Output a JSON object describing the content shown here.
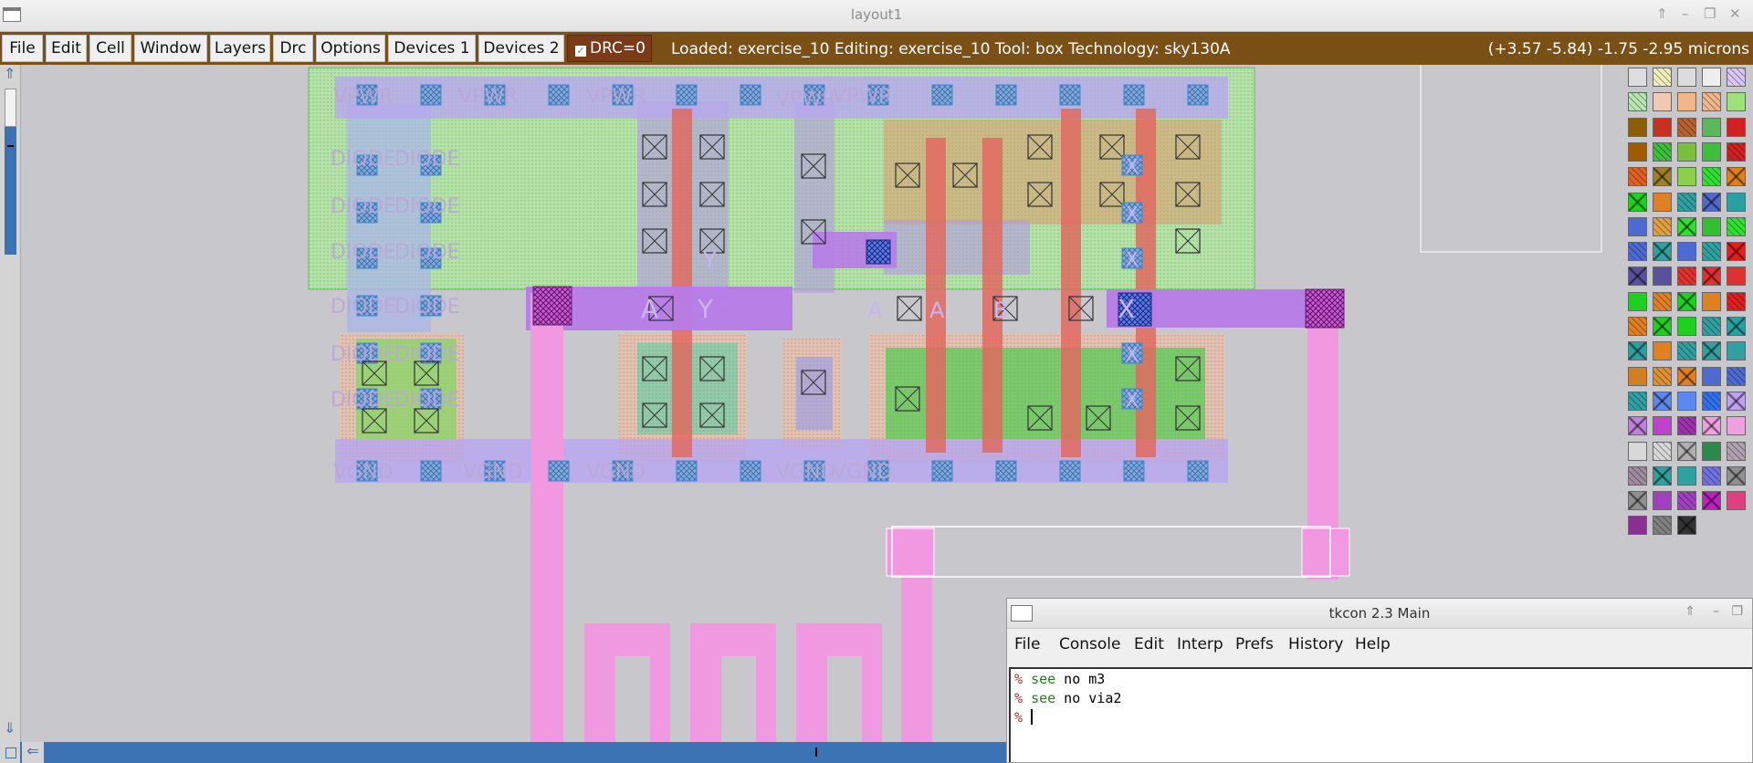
{
  "window": {
    "title": "layout1",
    "buttons": [
      "⇑",
      "–",
      "❐",
      "✕"
    ]
  },
  "menubar": {
    "items": [
      "File",
      "Edit",
      "Cell",
      "Window",
      "Layers",
      "Drc",
      "Options",
      "Devices 1",
      "Devices 2"
    ],
    "drc_label": "DRC=0",
    "status": "Loaded: exercise_10 Editing: exercise_10 Tool: box  Technology: sky130A",
    "coords": "(+3.57 -5.84) -1.75 -2.95 microns"
  },
  "layout": {
    "labels": {
      "vpwr": "VPWR",
      "vgnd": "VGND",
      "diode": "DIODE",
      "a": "A",
      "b": "B",
      "x": "X",
      "y": "Y"
    }
  },
  "tkcon": {
    "title": "tkcon 2.3 Main",
    "menu": [
      "File",
      "Console",
      "Edit",
      "Interp",
      "Prefs",
      "History",
      "Help"
    ],
    "lines": [
      {
        "prompt": "%",
        "cmd": "see",
        "rest": " no m3"
      },
      {
        "prompt": "%",
        "cmd": "see",
        "rest": " no via2"
      },
      {
        "prompt": "%",
        "cmd": "",
        "rest": ""
      }
    ]
  },
  "colors": {
    "menubar": "#7b5016",
    "scrollbar": "#3b73b5",
    "canvas": "#c8c8cc",
    "metal1": "#b68be8",
    "via": "#c84fd0",
    "nwell": "#b2e0a6",
    "poly": "#e06a60",
    "diff": "#55cc55",
    "pink_metal": "#f099e0"
  }
}
